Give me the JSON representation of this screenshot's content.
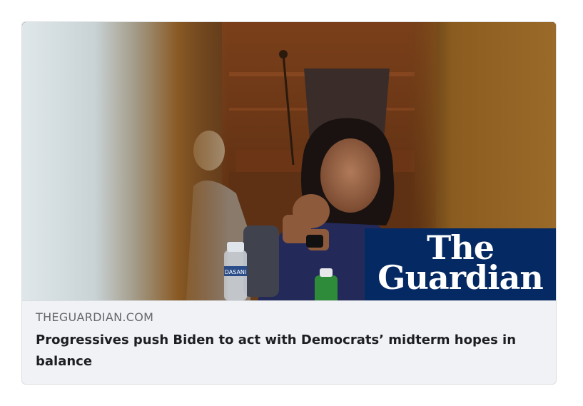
{
  "link_preview": {
    "source_domain": "THEGUARDIAN.COM",
    "headline": "Progressives push Biden to act with Democrats’ midterm hopes in balance",
    "image_alt": "news-photo"
  },
  "logo": {
    "line1": "The",
    "line2": "Guardian",
    "background_color": "#052962",
    "text_color": "#ffffff"
  },
  "photo_labels": {
    "bottle_label": "DASANI"
  },
  "colors": {
    "caption_bg": "#f0f2f5",
    "source_text": "#65676b",
    "headline_text": "#1c1e21",
    "border": "#dadde1"
  }
}
